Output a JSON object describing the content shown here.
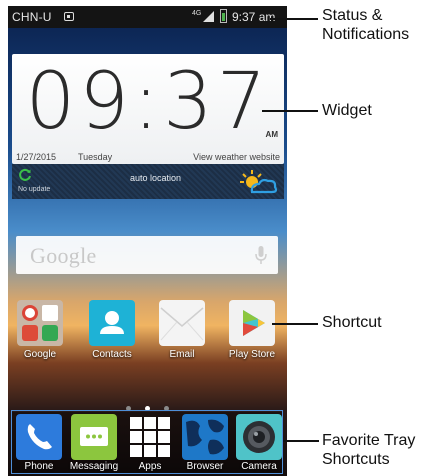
{
  "status_bar": {
    "carrier": "CHN-U",
    "network": "4G",
    "time": "9:37 am"
  },
  "clock_widget": {
    "time": "09:37",
    "ampm": "AM",
    "date": "1/27/2015",
    "day": "Tuesday",
    "weather_link": "View weather website",
    "update_status": "No update",
    "location": "auto location"
  },
  "search": {
    "placeholder": "Google"
  },
  "shortcuts": [
    {
      "label": "Google",
      "icon": "google-folder-icon"
    },
    {
      "label": "Contacts",
      "icon": "contacts-icon"
    },
    {
      "label": "Email",
      "icon": "email-icon"
    },
    {
      "label": "Play Store",
      "icon": "play-store-icon"
    }
  ],
  "page_indicator": {
    "pages": 3,
    "active_index": 1
  },
  "favorites_tray": [
    {
      "label": "Phone",
      "icon": "phone-icon"
    },
    {
      "label": "Messaging",
      "icon": "messaging-icon"
    },
    {
      "label": "Apps",
      "icon": "apps-grid-icon"
    },
    {
      "label": "Browser",
      "icon": "browser-icon"
    },
    {
      "label": "Camera",
      "icon": "camera-icon"
    }
  ],
  "callouts": {
    "status": "Status &\nNotifications",
    "widget": "Widget",
    "shortcut": "Shortcut",
    "tray": "Favorite Tray\nShortcuts"
  },
  "colors": {
    "status_bar_bg": "#141414",
    "tray_outline": "#4f8fd8",
    "contacts_tile": "#1eb2d6",
    "phone_tile": "#2d7bdc",
    "messaging_tile": "#8cc63e",
    "camera_tile": "#4fc3c8"
  }
}
